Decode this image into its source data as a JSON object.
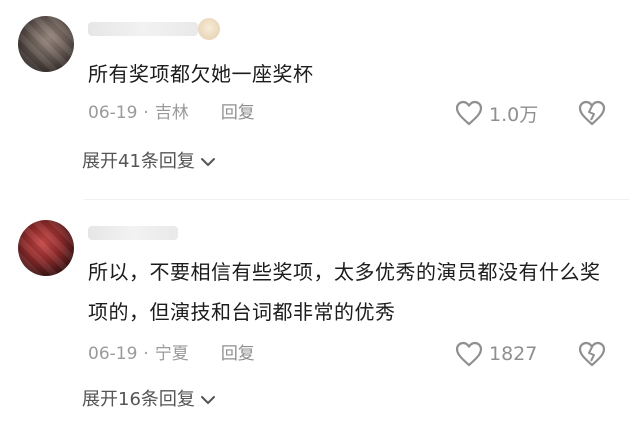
{
  "comments": [
    {
      "text": "所有奖项都欠她一座奖杯",
      "date": "06-19",
      "separator": "·",
      "location": "吉林",
      "reply_label": "回复",
      "likes": "1.0万",
      "expand_label": "展开41条回复"
    },
    {
      "text": "所以，不要相信有些奖项，太多优秀的演员都没有什么奖项的，但演技和台词都非常的优秀",
      "date": "06-19",
      "separator": "·",
      "location": "宁夏",
      "reply_label": "回复",
      "likes": "1827",
      "expand_label": "展开16条回复"
    }
  ]
}
